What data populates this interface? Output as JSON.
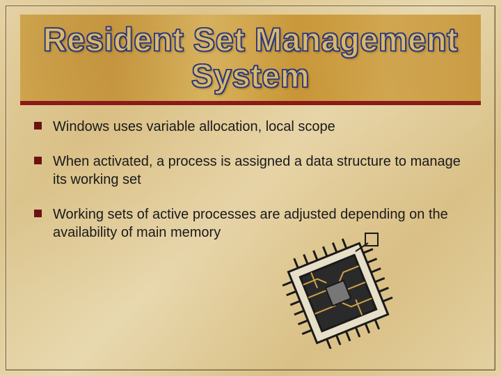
{
  "title": "Resident Set Management System",
  "bullets": [
    "Windows uses variable allocation, local scope",
    "When activated, a process is assigned a data structure to manage its working set",
    "Working sets of active processes are adjusted depending on the availability of main memory"
  ],
  "icon": "cpu-chip-icon",
  "colors": {
    "accent": "#8b1a1a",
    "title_stroke": "#2b3a8a",
    "title_fill": "#d9b868"
  }
}
